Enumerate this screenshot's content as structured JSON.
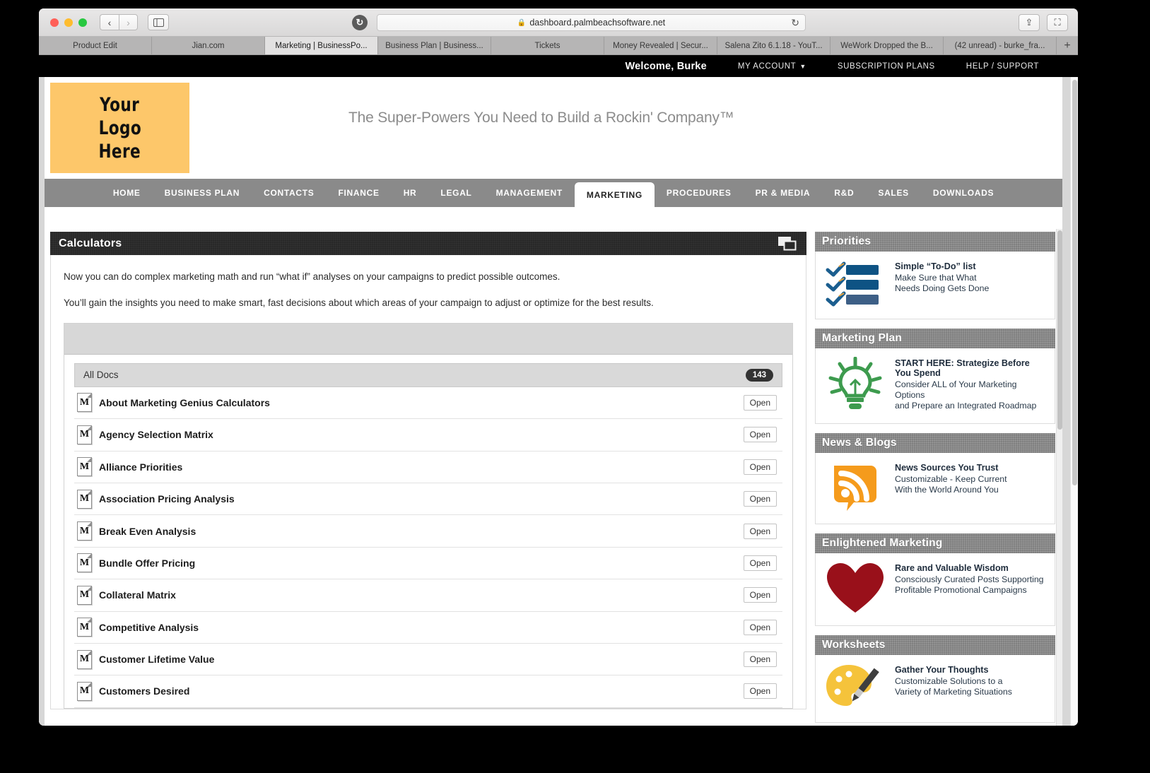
{
  "browser": {
    "url": "dashboard.palmbeachsoftware.net",
    "lock_icon": "lock-icon",
    "reload_icon": "reload-icon",
    "back_icon": "back-arrow-icon",
    "forward_icon": "forward-arrow-icon",
    "sidebar_icon": "sidebar-toggle-icon",
    "share_icon": "share-icon",
    "newtab_icon": "new-tab-icon",
    "tab_plus": "+",
    "tabs": [
      {
        "label": "Product Edit",
        "active": false
      },
      {
        "label": "Jian.com",
        "active": false
      },
      {
        "label": "Marketing | BusinessPo...",
        "active": true
      },
      {
        "label": "Business Plan | Business...",
        "active": false
      },
      {
        "label": "Tickets",
        "active": false
      },
      {
        "label": "Money Revealed | Secur...",
        "active": false
      },
      {
        "label": "Salena Zito 6.1.18 - YouT...",
        "active": false
      },
      {
        "label": "WeWork Dropped the B...",
        "active": false
      },
      {
        "label": "(42 unread) - burke_fra...",
        "active": false
      }
    ]
  },
  "topnav": {
    "welcome": "Welcome, Burke",
    "items": [
      {
        "label": "MY ACCOUNT",
        "has_caret": true
      },
      {
        "label": "SUBSCRIPTION PLANS",
        "has_caret": false
      },
      {
        "label": "HELP / SUPPORT",
        "has_caret": false
      }
    ]
  },
  "branding": {
    "logo_lines": [
      "Your",
      "Logo",
      "Here"
    ],
    "logo_color": "#fdc76a",
    "tagline": "The Super-Powers You Need to Build a Rockin' Company™"
  },
  "mainnav": {
    "items": [
      {
        "label": "HOME",
        "active": false
      },
      {
        "label": "BUSINESS PLAN",
        "active": false
      },
      {
        "label": "CONTACTS",
        "active": false
      },
      {
        "label": "FINANCE",
        "active": false
      },
      {
        "label": "HR",
        "active": false
      },
      {
        "label": "LEGAL",
        "active": false
      },
      {
        "label": "MANAGEMENT",
        "active": false
      },
      {
        "label": "MARKETING",
        "active": true
      },
      {
        "label": "PROCEDURES",
        "active": false
      },
      {
        "label": "PR & MEDIA",
        "active": false
      },
      {
        "label": "R&D",
        "active": false
      },
      {
        "label": "SALES",
        "active": false
      },
      {
        "label": "DOWNLOADS",
        "active": false
      }
    ]
  },
  "calculators": {
    "title": "Calculators",
    "window_icon": "restore-window-icon",
    "intro_1": "Now you can do complex marketing math and run “what if” analyses on your campaigns to predict possible outcomes.",
    "intro_2": "You’ll gain the insights you need to make smart, fast decisions about which areas of your campaign to adjust or optimize for the best results.",
    "list_header": "All Docs",
    "count_badge": "143",
    "open_label": "Open",
    "doc_icon_letter": "M",
    "docs": [
      {
        "title": "About Marketing Genius Calculators"
      },
      {
        "title": "Agency Selection Matrix"
      },
      {
        "title": "Alliance Priorities"
      },
      {
        "title": "Association Pricing Analysis"
      },
      {
        "title": "Break Even Analysis"
      },
      {
        "title": "Bundle Offer Pricing"
      },
      {
        "title": "Collateral Matrix"
      },
      {
        "title": "Competitive Analysis"
      },
      {
        "title": "Customer Lifetime Value"
      },
      {
        "title": "Customers Desired"
      }
    ]
  },
  "sidebar": {
    "widgets": [
      {
        "title": "Priorities",
        "icon": "checklist-icon",
        "heading": "Simple “To-Do” list",
        "line1": "Make Sure that What",
        "line2": "Needs Doing Gets Done"
      },
      {
        "title": "Marketing Plan",
        "icon": "lightbulb-icon",
        "heading": "START HERE: Strategize Before You Spend",
        "line1": "Consider ALL of Your Marketing Options",
        "line2": "and Prepare an Integrated Roadmap"
      },
      {
        "title": "News & Blogs",
        "icon": "rss-icon",
        "heading": "News Sources You Trust",
        "line1": "Customizable - Keep Current",
        "line2": "With the World Around You"
      },
      {
        "title": "Enlightened Marketing",
        "icon": "heart-icon",
        "heading": "Rare and Valuable Wisdom",
        "line1": "Consciously Curated Posts Supporting",
        "line2": "Profitable Promotional Campaigns"
      },
      {
        "title": "Worksheets",
        "icon": "palette-icon",
        "heading": "Gather Your Thoughts",
        "line1": "Customizable Solutions to a",
        "line2": "Variety of Marketing Situations"
      }
    ]
  },
  "colors": {
    "logo_orange": "#fdc76a",
    "nav_gray": "#8a8a8a",
    "panel_dark": "#282828",
    "widget_gray": "#808080",
    "rss_orange": "#f59b1c",
    "heart_red": "#99101a",
    "bulb_green": "#3d9b4e",
    "check_blue": "#1b5e8f"
  }
}
